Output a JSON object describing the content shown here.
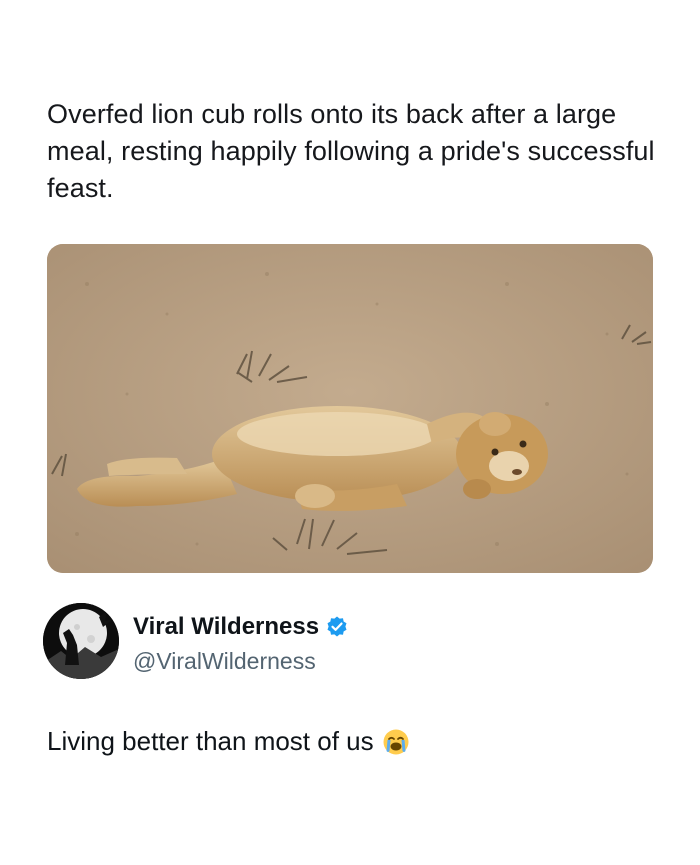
{
  "post": {
    "caption": "Overfed lion cub rolls onto its back after a large meal, resting happily following a pride's successful feast.",
    "image_description_icon": "lion-cub-photo",
    "author": {
      "name": "Viral Wilderness",
      "handle": "@ViralWilderness",
      "verified": true,
      "avatar_icon": "wolf-howling-moon-avatar"
    },
    "tweet_text": "Living better than most of us",
    "tweet_emoji_icon": "loudly-crying-face-emoji"
  },
  "colors": {
    "text": "#0f1419",
    "handle": "#536471",
    "verified_badge": "#1d9bf0",
    "ground": "#b79f83"
  }
}
